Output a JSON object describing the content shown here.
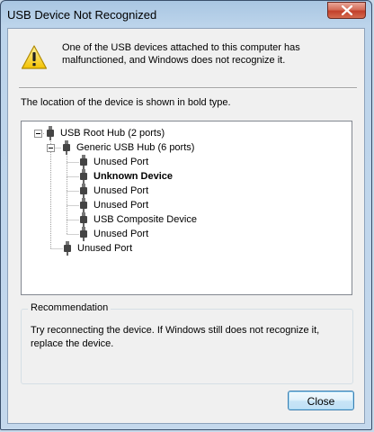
{
  "window": {
    "title": "USB Device Not Recognized"
  },
  "warning": {
    "icon": "warning-icon",
    "message": "One of the USB devices attached to this computer has malfunctioned, and Windows does not recognize it."
  },
  "location_text": "The location of the device is shown in bold type.",
  "tree": {
    "root": {
      "label": "USB Root Hub (2 ports)",
      "expanded": true
    },
    "hub": {
      "label": "Generic USB Hub (6 ports)",
      "expanded": true
    },
    "hub_ports": [
      {
        "label": "Unused Port",
        "bold": false
      },
      {
        "label": "Unknown Device",
        "bold": true
      },
      {
        "label": "Unused Port",
        "bold": false
      },
      {
        "label": "Unused Port",
        "bold": false
      },
      {
        "label": "USB Composite Device",
        "bold": false
      },
      {
        "label": "Unused Port",
        "bold": false
      }
    ],
    "root_port": {
      "label": "Unused Port"
    }
  },
  "recommendation": {
    "title": "Recommendation",
    "body": "Try reconnecting the device. If Windows still does not recognize it, replace the device."
  },
  "buttons": {
    "close_label": "Close"
  },
  "colors": {
    "accent": "#3c7fb1",
    "titlebar": "#bcd4eb",
    "close_red": "#c2402b"
  }
}
